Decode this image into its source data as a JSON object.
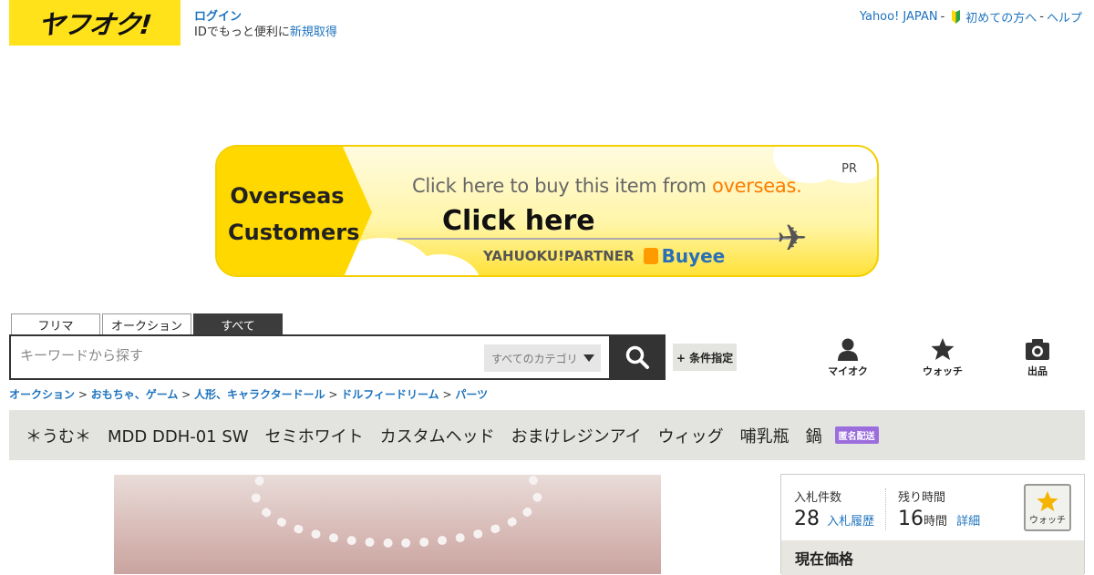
{
  "header": {
    "logo_text": "ヤフオク!",
    "login_label": "ログイン",
    "login_prompt": "IDでもっと便利に",
    "register_label": "新規取得",
    "links": {
      "yahoo": "Yahoo! JAPAN",
      "sep1": "-",
      "beginner": "初めての方へ",
      "sep2": "-",
      "help": "ヘルプ"
    }
  },
  "banner": {
    "left_line1": "Overseas",
    "left_line2": "Customers",
    "pr": "PR",
    "tagline_prefix": "Click here to buy this item from ",
    "tagline_highlight": "overseas.",
    "cta": "Click here",
    "partner": "YAHUOKU!PARTNER",
    "brand": "Buyee"
  },
  "search": {
    "tabs": [
      "フリマ",
      "オークション",
      "すべて"
    ],
    "active_tab": "すべて",
    "placeholder": "キーワードから探す",
    "category": "すべてのカテゴリ",
    "conditions": "+ 条件指定"
  },
  "iconnav": {
    "my": "マイオク",
    "watch": "ウォッチ",
    "sell": "出品"
  },
  "breadcrumb": [
    "オークション",
    "おもちゃ、ゲーム",
    "人形、キャラクタードール",
    "ドルフィードリーム",
    "パーツ"
  ],
  "item": {
    "title": "＊うむ＊　MDD DDH-01 SW　セミホワイト　カスタムヘッド　おまけレジンアイ　ウィッグ　哺乳瓶　鍋",
    "badge": "匿名配送"
  },
  "info": {
    "bids_label": "入札件数",
    "bids_value": "28",
    "bids_link": "入札履歴",
    "time_label": "残り時間",
    "time_value": "16",
    "time_unit": "時間",
    "time_link": "詳細",
    "watch_label": "ウォッチ",
    "price_label": "現在価格"
  },
  "colors": {
    "brand_yellow": "#ffe21a",
    "link_blue": "#1e73be",
    "dark": "#333333",
    "badge_purple": "#9b6ddd"
  }
}
